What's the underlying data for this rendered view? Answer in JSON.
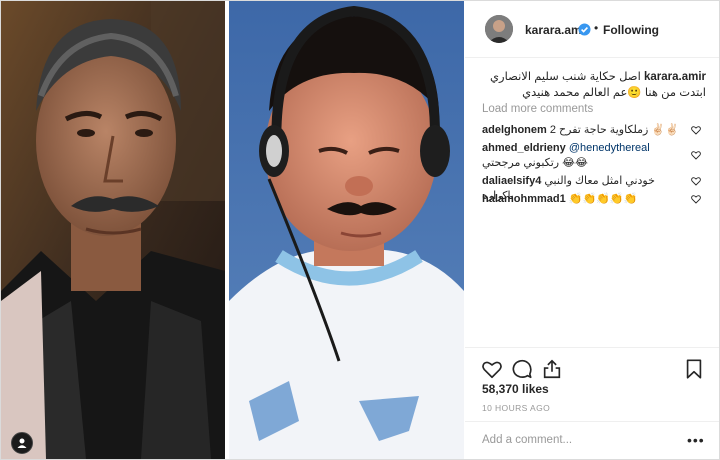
{
  "post": {
    "username": "karara.amir",
    "follow_status": "Following",
    "separator": "•"
  },
  "caption": {
    "username": "karara.amir",
    "text": "اصل حكاية شنب سليم الانصاري ابتدت من هنا 🙂عم العالم محمد هنيدي"
  },
  "load_more": "Load more comments",
  "comments": [
    {
      "user": "adelghonem",
      "text": "2 زملكاوية حاجة تفرح ✌🏻✌🏻",
      "mention": ""
    },
    {
      "user": "ahmed_eldrieny",
      "text": " رتكبوني مرجحتي 😂😂",
      "mention": "@henedythereal"
    },
    {
      "user": "daliaelsify4",
      "text": " خودني امثل معاك والنبي باكراره",
      "mention": ""
    },
    {
      "user": "halamohmmad1",
      "text": " 👏👏👏👏👏",
      "mention": ""
    }
  ],
  "likes": "58,370 likes",
  "time": "10 HOURS AGO",
  "add_comment_placeholder": "Add a comment...",
  "more_options": "•••",
  "icons": {
    "like": "heart-icon",
    "comment": "comment-icon",
    "share": "share-icon",
    "save": "bookmark-icon",
    "verified": "verified-badge-icon",
    "tag": "user-tag-icon"
  },
  "colors": {
    "verified": "#3897f0",
    "text": "#262626",
    "muted": "#999999",
    "border": "#efefef"
  }
}
